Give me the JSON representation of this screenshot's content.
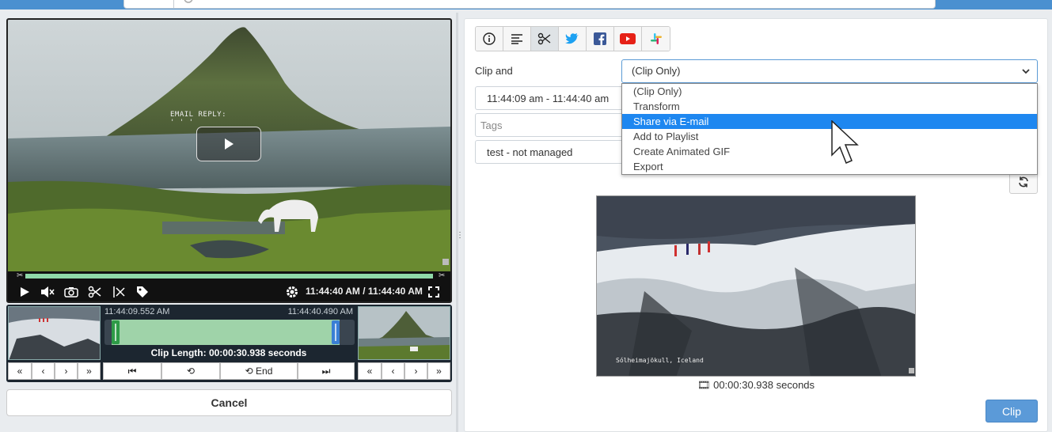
{
  "video": {
    "overlay_text": "EMAIL REPLY:",
    "overlay_subtext": "' ' '",
    "time_display": "11:44:40 AM / 11:44:40 AM"
  },
  "clip_range": {
    "start_time": "11:44:09.552 AM",
    "end_time": "11:44:40.490 AM",
    "clip_length": "Clip Length: 00:00:30.938 seconds",
    "start_fraction": 0.03,
    "end_fraction": 0.94
  },
  "buttons": {
    "end_label": "End",
    "cancel": "Cancel",
    "clip": "Clip"
  },
  "form": {
    "clip_and_label": "Clip and",
    "selected_option": "(Clip Only)",
    "options": [
      "(Clip Only)",
      "Transform",
      "Share via E-mail",
      "Add to Playlist",
      "Create Animated GIF",
      "Export"
    ],
    "highlighted_option": "Share via E-mail",
    "time_range": "11:44:09 am - 11:44:40 am",
    "tags_placeholder": "Tags",
    "source": "test - not managed"
  },
  "preview": {
    "caption": "Sólheimajökull, Iceland",
    "duration": "00:00:30.938 seconds"
  },
  "tabs": [
    "info-icon",
    "align-left-icon",
    "scissors-icon",
    "twitter-icon",
    "facebook-icon",
    "youtube-icon",
    "slack-icon"
  ],
  "colors": {
    "accent": "#1e87f0",
    "progress": "#8fd9a8",
    "clip_button": "#5b9ad8"
  }
}
